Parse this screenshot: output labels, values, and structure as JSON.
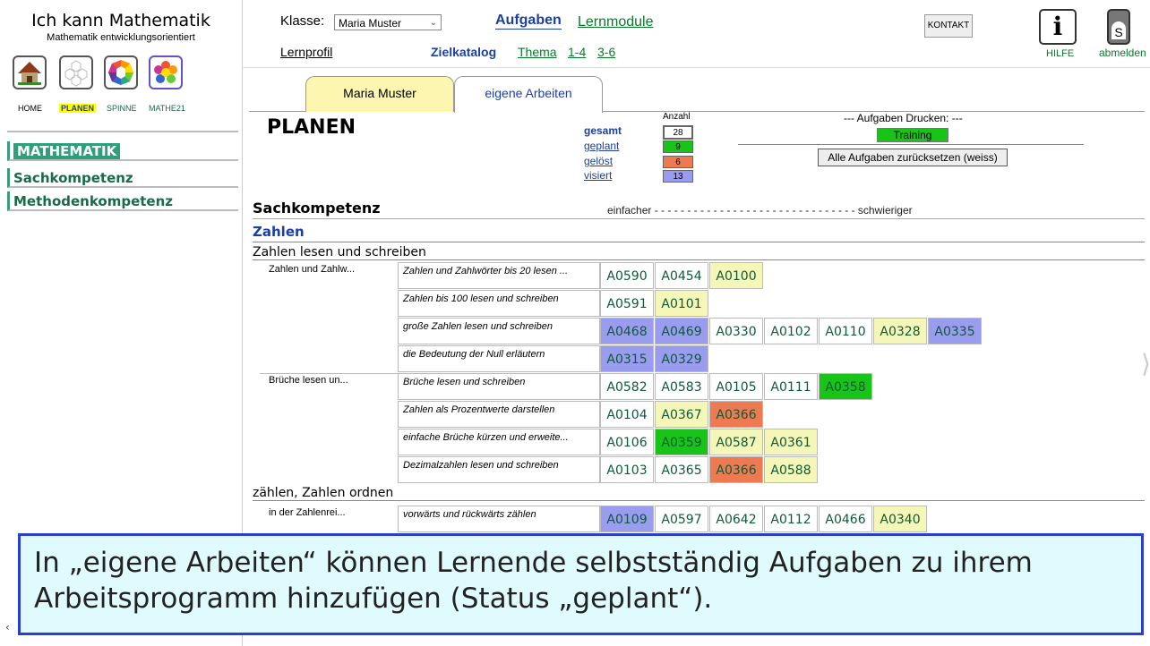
{
  "app": {
    "title": "Ich kann Mathematik",
    "subtitle": "Mathematik entwicklungsorientiert"
  },
  "nav": [
    {
      "label": "HOME",
      "icon": "house-icon"
    },
    {
      "label": "PLANEN",
      "icon": "honeycomb-icon"
    },
    {
      "label": "SPINNE",
      "icon": "spider-web-icon"
    },
    {
      "label": "MATHE21",
      "icon": "flower-icon"
    }
  ],
  "sidebar": {
    "items": [
      {
        "label": "MATHEMATIK"
      },
      {
        "label": "Sachkompetenz"
      },
      {
        "label": "Methodenkompetenz"
      }
    ]
  },
  "header": {
    "klasse_label": "Klasse:",
    "klasse_value": "Maria Muster",
    "aufgaben": "Aufgaben",
    "lernmodule": "Lernmodule",
    "lernprofil": "Lernprofil",
    "zielkatalog": "Zielkatalog",
    "thema": "Thema",
    "range1": "1-4",
    "range2": "3-6",
    "kontakt": "KONTAKT",
    "hilfe": "HILFE",
    "abmelden": "abmelden",
    "info_glyph": "i",
    "user_initial": "S"
  },
  "tabs": [
    {
      "label": "Maria Muster"
    },
    {
      "label": "eigene Arbeiten"
    }
  ],
  "planen": {
    "title": "PLANEN",
    "anzahl_label": "Anzahl",
    "stats": [
      {
        "label": "gesamt",
        "value": "28",
        "color": "#ffffff"
      },
      {
        "label": "geplant",
        "value": "9",
        "color": "#18c418"
      },
      {
        "label": "gelöst",
        "value": "6",
        "color": "#ee7a52"
      },
      {
        "label": "visiert",
        "value": "13",
        "color": "#9a9cf0"
      }
    ],
    "drucken_label": "--- Aufgaben Drucken: ---",
    "training": "Training",
    "reset": "Alle Aufgaben zurücksetzen (weiss)"
  },
  "section": {
    "title": "Sachkompetenz",
    "scale": "einfacher - - - - - - - - - - - - - - - - - - - - - - - - - - - - - - - schwieriger"
  },
  "subsection": "Zahlen",
  "categories": [
    {
      "label": "Zahlen lesen und schreiben"
    },
    {
      "label": "zählen, Zahlen ordnen"
    }
  ],
  "topics": [
    {
      "label": "Zahlen und Zahlw..."
    },
    {
      "label": "Brüche lesen un..."
    },
    {
      "label": "in der Zahlenrei..."
    }
  ],
  "goals": [
    {
      "label": "Zahlen und Zahlwörter bis 20 lesen ...",
      "tasks": [
        {
          "id": "A0590",
          "s": "w"
        },
        {
          "id": "A0454",
          "s": "w"
        },
        {
          "id": "A0100",
          "s": "y"
        }
      ]
    },
    {
      "label": "Zahlen bis 100 lesen und schreiben",
      "tasks": [
        {
          "id": "A0591",
          "s": "w"
        },
        {
          "id": "A0101",
          "s": "y"
        }
      ]
    },
    {
      "label": "große Zahlen lesen und schreiben",
      "tasks": [
        {
          "id": "A0468",
          "s": "b"
        },
        {
          "id": "A0469",
          "s": "b"
        },
        {
          "id": "A0330",
          "s": "w"
        },
        {
          "id": "A0102",
          "s": "w"
        },
        {
          "id": "A0110",
          "s": "w"
        },
        {
          "id": "A0328",
          "s": "y"
        },
        {
          "id": "A0335",
          "s": "b"
        }
      ]
    },
    {
      "label": "die Bedeutung der Null erläutern",
      "tasks": [
        {
          "id": "A0315",
          "s": "b"
        },
        {
          "id": "A0329",
          "s": "b"
        }
      ]
    },
    {
      "label": "Brüche lesen und schreiben",
      "tasks": [
        {
          "id": "A0582",
          "s": "w"
        },
        {
          "id": "A0583",
          "s": "w"
        },
        {
          "id": "A0105",
          "s": "w"
        },
        {
          "id": "A0111",
          "s": "w"
        },
        {
          "id": "A0358",
          "s": "g"
        }
      ]
    },
    {
      "label": "Zahlen als Prozentwerte darstellen",
      "tasks": [
        {
          "id": "A0104",
          "s": "w"
        },
        {
          "id": "A0367",
          "s": "y"
        },
        {
          "id": "A0366",
          "s": "r"
        }
      ]
    },
    {
      "label": "einfache Brüche kürzen und erweite...",
      "tasks": [
        {
          "id": "A0106",
          "s": "w"
        },
        {
          "id": "A0359",
          "s": "g"
        },
        {
          "id": "A0587",
          "s": "y"
        },
        {
          "id": "A0361",
          "s": "y"
        }
      ]
    },
    {
      "label": "Dezimalzahlen lesen und schreiben",
      "tasks": [
        {
          "id": "A0103",
          "s": "w"
        },
        {
          "id": "A0365",
          "s": "w"
        },
        {
          "id": "A0366",
          "s": "r"
        },
        {
          "id": "A0588",
          "s": "y"
        }
      ]
    },
    {
      "label": "vorwärts und rückwärts zählen",
      "tasks": [
        {
          "id": "A0109",
          "s": "b"
        },
        {
          "id": "A0597",
          "s": "w"
        },
        {
          "id": "A0642",
          "s": "w"
        },
        {
          "id": "A0112",
          "s": "w"
        },
        {
          "id": "A0466",
          "s": "w"
        },
        {
          "id": "A0340",
          "s": "y"
        }
      ]
    }
  ],
  "caption": "In „eigene Arbeiten“ können Lernende selbstständig Aufgaben zu ihrem Arbeitsprogramm hinzufügen (Status „geplant“).",
  "scroll_left_glyph": "‹"
}
